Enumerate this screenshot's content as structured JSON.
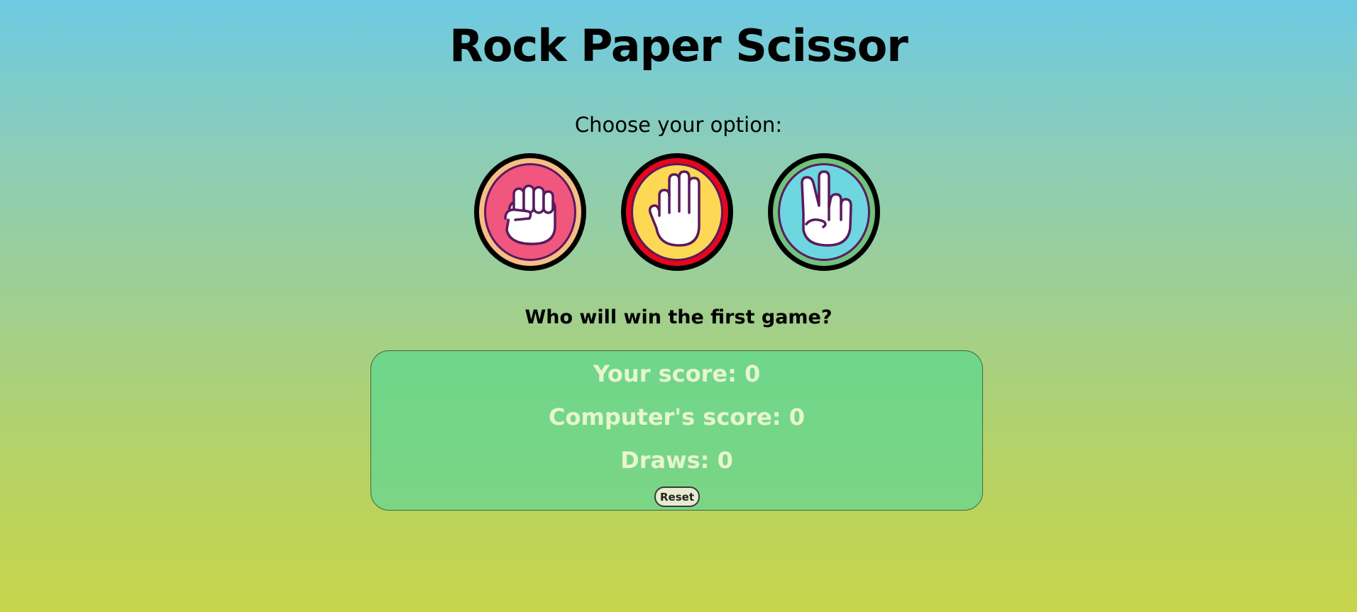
{
  "header": {
    "title": "Rock Paper Scissor"
  },
  "chooser": {
    "label": "Choose your option:",
    "options": [
      {
        "icon": "rock-hand-icon",
        "fill": "#f0567e",
        "ring": "#f7bd84"
      },
      {
        "icon": "paper-hand-icon",
        "fill": "#fdd855",
        "ring": "#e9061c"
      },
      {
        "icon": "scissors-hand-icon",
        "fill": "#6dd6de",
        "ring": "#6fc37b"
      }
    ]
  },
  "status": {
    "message": "Who will win the first game?"
  },
  "scoreboard": {
    "player_score": "Your score: 0",
    "computer_score": "Computer's score: 0",
    "draws": "Draws: 0",
    "reset_label": "Reset"
  },
  "colors": {
    "outline": "#000000",
    "hand_outline": "#5a1a5e",
    "hand_fill": "#ffffff"
  }
}
